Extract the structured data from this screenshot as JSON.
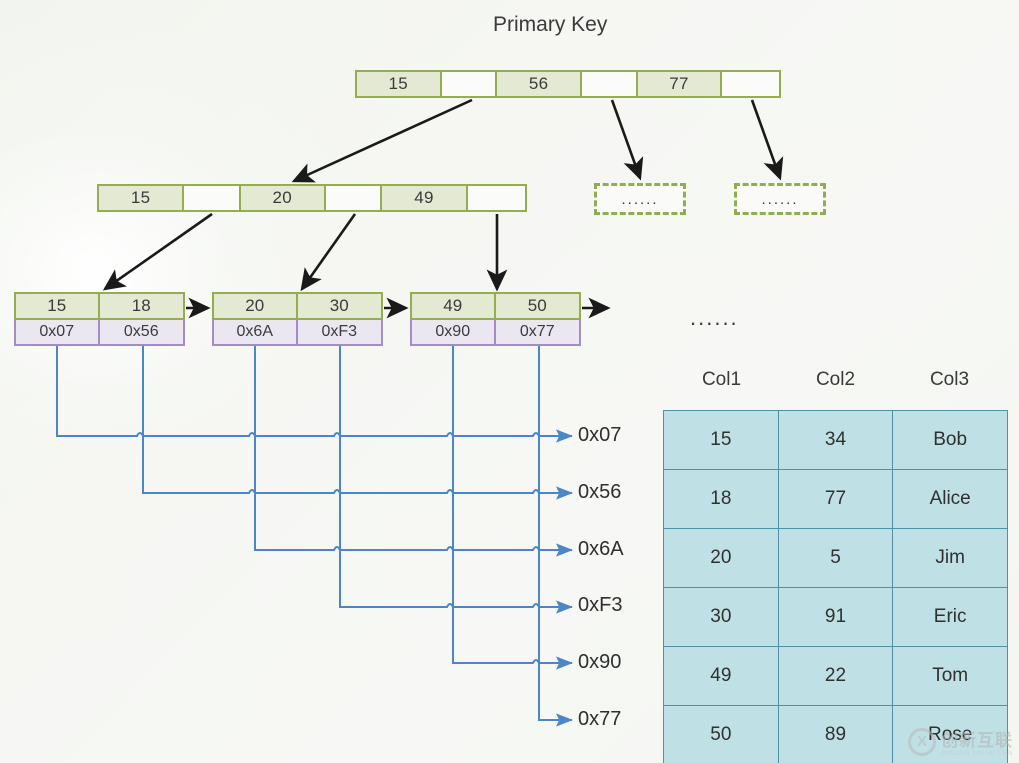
{
  "title": "Primary Key",
  "colors": {
    "green_border": "#94ad4e",
    "green_fill": "#e3e9d2",
    "purple_border": "#a48cc4",
    "purple_fill": "#ebe7f1",
    "table_fill": "#bfe1e5",
    "table_border": "#4d93a3",
    "pointer_line": "#4a86c8",
    "tree_arrow": "#1a1a1a"
  },
  "ellipsis": "......",
  "root_node": {
    "cells": [
      "15",
      "",
      "56",
      "",
      "77",
      ""
    ]
  },
  "internal_node": {
    "cells": [
      "15",
      "",
      "20",
      "",
      "49",
      ""
    ]
  },
  "leaf_nodes": [
    {
      "keys": [
        "15",
        "18"
      ],
      "pointers": [
        "0x07",
        "0x56"
      ]
    },
    {
      "keys": [
        "20",
        "30"
      ],
      "pointers": [
        "0x6A",
        "0xF3"
      ]
    },
    {
      "keys": [
        "49",
        "50"
      ],
      "pointers": [
        "0x90",
        "0x77"
      ]
    }
  ],
  "placeholder_boxes": [
    "......",
    "......"
  ],
  "leaf_level_ellipsis": "......",
  "address_labels": [
    "0x07",
    "0x56",
    "0x6A",
    "0xF3",
    "0x90",
    "0x77"
  ],
  "data_table": {
    "headers": [
      "Col1",
      "Col2",
      "Col3"
    ],
    "rows": [
      [
        "15",
        "34",
        "Bob"
      ],
      [
        "18",
        "77",
        "Alice"
      ],
      [
        "20",
        "5",
        "Jim"
      ],
      [
        "30",
        "91",
        "Eric"
      ],
      [
        "49",
        "22",
        "Tom"
      ],
      [
        "50",
        "89",
        "Rose"
      ]
    ]
  },
  "watermark": {
    "mark": "X",
    "cn": "创新互联",
    "en": "CHUANG XIN HU LIAN"
  }
}
